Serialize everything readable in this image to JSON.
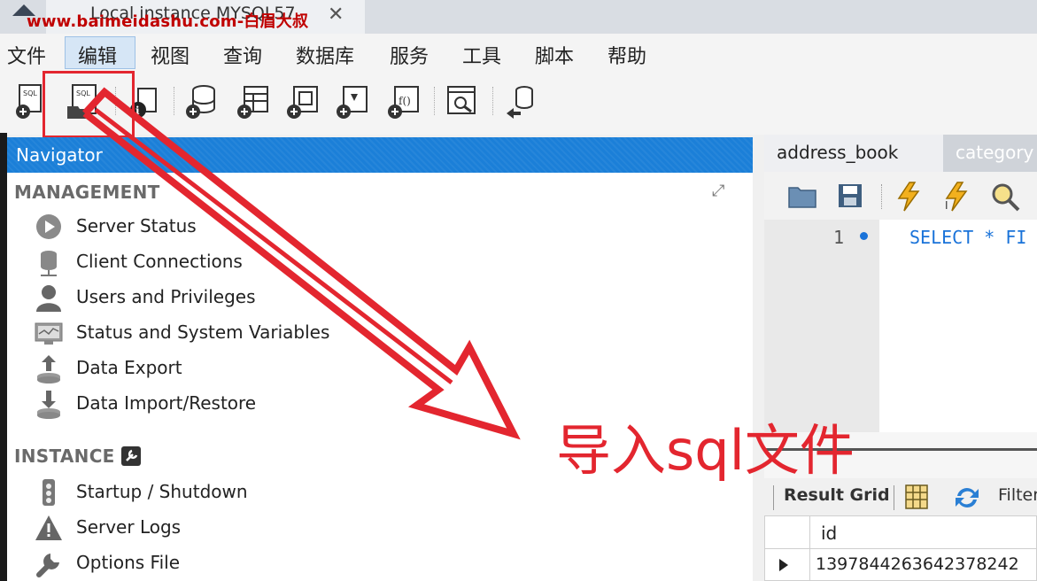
{
  "window": {
    "tab_title": "Local instance MYSQL57",
    "close_glyph": "✕",
    "watermark": "www.baimeidashu.com-白眉大叔"
  },
  "menu": {
    "items": [
      "文件",
      "编辑",
      "视图",
      "查询",
      "数据库",
      "服务",
      "工具",
      "脚本",
      "帮助"
    ],
    "active": "编辑"
  },
  "toolbar": {
    "buttons": [
      "new-sql-tab-icon",
      "open-sql-file-icon",
      "inspector-icon",
      "create-schema-icon",
      "create-table-icon",
      "create-view-icon",
      "create-procedure-icon",
      "create-function-icon",
      "search-table-data-icon",
      "reconnect-icon"
    ],
    "highlighted": "open-sql-file-icon"
  },
  "navigator": {
    "title": "Navigator",
    "management": {
      "title": "MANAGEMENT",
      "items": [
        {
          "label": "Server Status",
          "icon": "server-status-icon"
        },
        {
          "label": "Client Connections",
          "icon": "client-connections-icon"
        },
        {
          "label": "Users and Privileges",
          "icon": "user-icon"
        },
        {
          "label": "Status and System Variables",
          "icon": "monitor-icon"
        },
        {
          "label": "Data Export",
          "icon": "data-export-icon"
        },
        {
          "label": "Data Import/Restore",
          "icon": "data-import-icon"
        }
      ]
    },
    "instance": {
      "title": "INSTANCE",
      "items": [
        {
          "label": "Startup / Shutdown",
          "icon": "startup-shutdown-icon"
        },
        {
          "label": "Server Logs",
          "icon": "warning-icon"
        },
        {
          "label": "Options File",
          "icon": "wrench-icon"
        }
      ]
    }
  },
  "editor": {
    "tabs": [
      "address_book",
      "category"
    ],
    "line_number": "1",
    "code": "SELECT * FI"
  },
  "results": {
    "grid_label": "Result Grid",
    "filter_label": "Filter",
    "column": "id",
    "row_value": "1397844263642378242"
  },
  "annotation": {
    "text": "导入sql文件",
    "color": "#e3262f"
  }
}
